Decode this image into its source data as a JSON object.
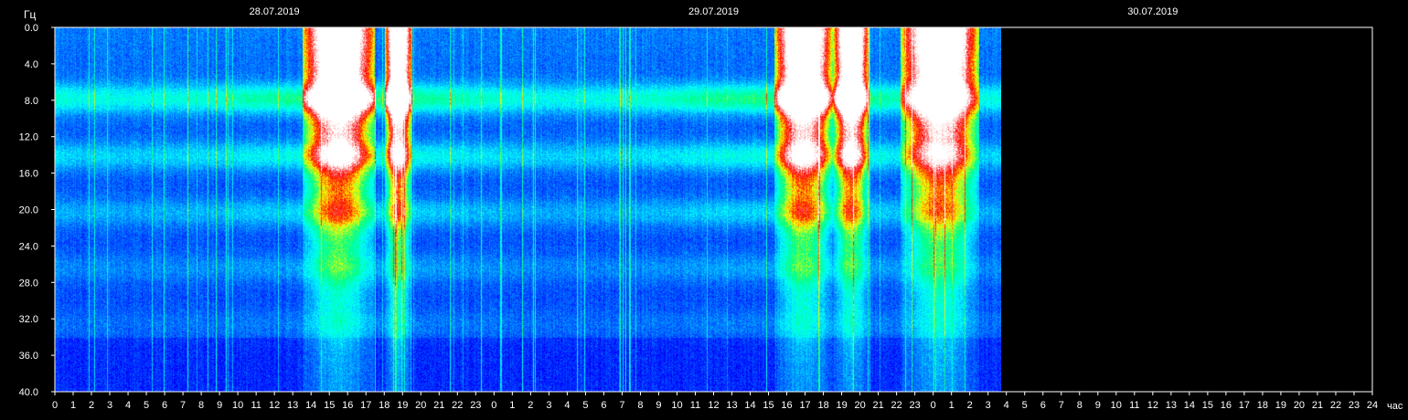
{
  "chart_data": {
    "type": "heatmap",
    "title": "",
    "ylabel": "Гц",
    "xlabel": "час",
    "ylim": [
      0,
      40
    ],
    "y_ticks": [
      "0.0",
      "4.0",
      "8.0",
      "12.0",
      "16.0",
      "20.0",
      "24.0",
      "28.0",
      "32.0",
      "36.0",
      "40.0"
    ],
    "x_ticks": [
      "0",
      "1",
      "2",
      "3",
      "4",
      "5",
      "6",
      "7",
      "8",
      "9",
      "10",
      "11",
      "12",
      "13",
      "14",
      "15",
      "16",
      "17",
      "18",
      "19",
      "20",
      "21",
      "22",
      "23",
      "0",
      "1",
      "2",
      "3",
      "4",
      "5",
      "6",
      "7",
      "8",
      "9",
      "10",
      "11",
      "12",
      "13",
      "14",
      "15",
      "16",
      "17",
      "18",
      "19",
      "20",
      "21",
      "22",
      "23",
      "0",
      "1",
      "2",
      "3",
      "4",
      "5",
      "6",
      "7",
      "8",
      "9",
      "10",
      "11",
      "12",
      "13",
      "14",
      "15",
      "16",
      "17",
      "18",
      "19",
      "20",
      "21",
      "22",
      "23",
      "24"
    ],
    "dates": [
      "28.07.2019",
      "29.07.2019",
      "30.07.2019"
    ],
    "x_range_hours": [
      0,
      72
    ],
    "data_end_hour": 51.7,
    "colormap": [
      "#000080",
      "#0000ff",
      "#0080ff",
      "#00ffff",
      "#00ff80",
      "#ffff00",
      "#ff0000",
      "#ffffff"
    ],
    "background": "#000000",
    "bands_hz": [
      7.8,
      14.1,
      20.3,
      26.4,
      32.5
    ],
    "bursts": [
      {
        "start_hour": 13.5,
        "end_hour": 17.5
      },
      {
        "start_hour": 18.0,
        "end_hour": 19.5
      },
      {
        "start_hour": 39.3,
        "end_hour": 42.5
      },
      {
        "start_hour": 42.5,
        "end_hour": 44.5
      },
      {
        "start_hour": 46.2,
        "end_hour": 50.5
      }
    ]
  }
}
